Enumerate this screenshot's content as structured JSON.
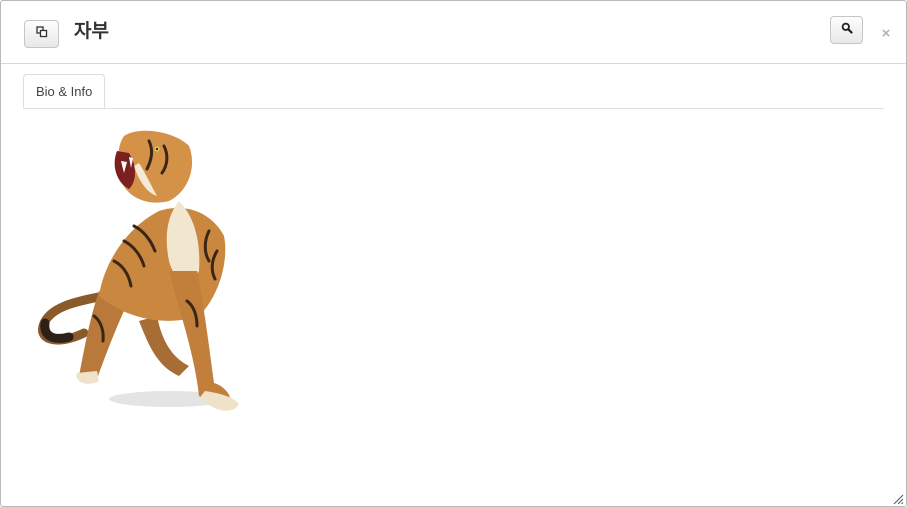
{
  "window": {
    "title": "자부"
  },
  "header": {
    "popout_icon": "popout-icon",
    "search_icon": "search-icon",
    "close_glyph": "×"
  },
  "tabs": [
    {
      "label": "Bio & Info",
      "active": true
    }
  ],
  "content": {
    "image_subject": "tiger",
    "accent_colors": [
      "#c9873f",
      "#7a4a22",
      "#f2e6cf"
    ]
  }
}
